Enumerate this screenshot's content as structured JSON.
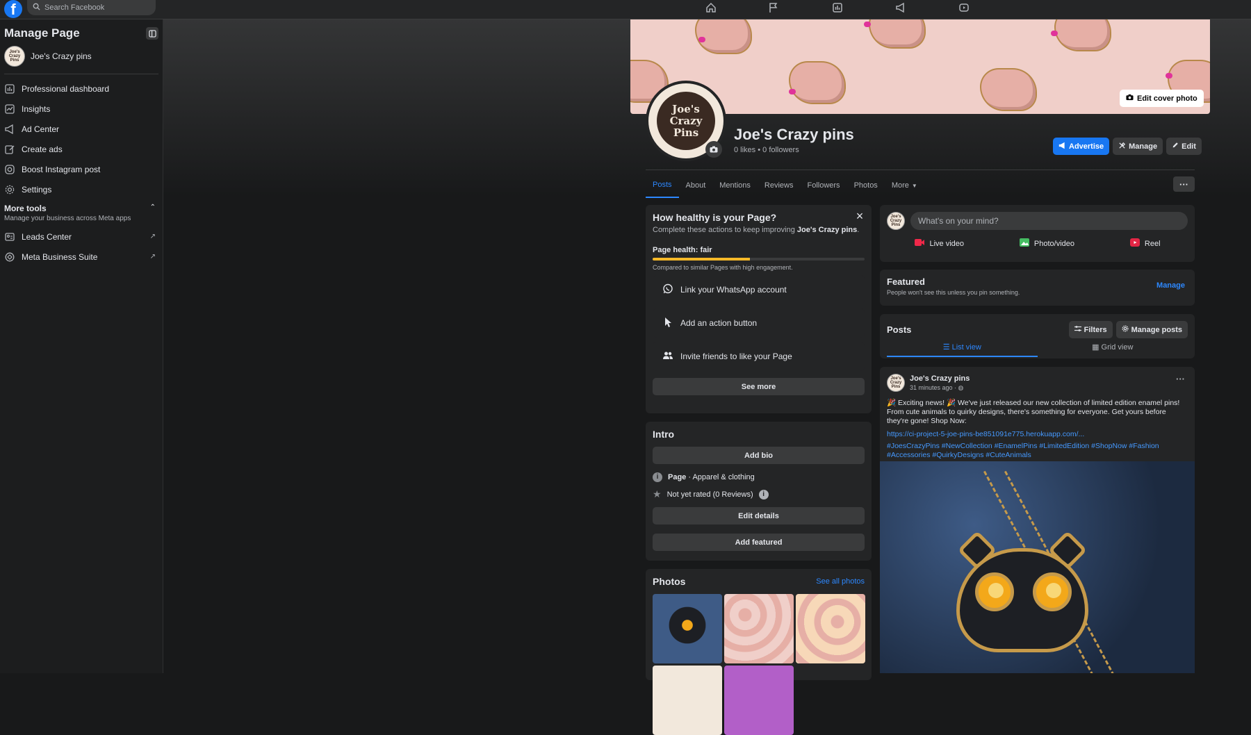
{
  "topbar": {
    "logo": "f",
    "search_placeholder": "Search Facebook",
    "nav_icons": [
      "home-icon",
      "flag-icon",
      "insights-icon",
      "megaphone-icon",
      "video-icon"
    ]
  },
  "sidebar": {
    "title": "Manage Page",
    "page_name": "Joe's Crazy pins",
    "items": [
      {
        "label": "Professional dashboard",
        "icon": "dashboard-icon"
      },
      {
        "label": "Insights",
        "icon": "insights-icon"
      },
      {
        "label": "Ad Center",
        "icon": "megaphone-icon"
      },
      {
        "label": "Create ads",
        "icon": "edit-icon"
      },
      {
        "label": "Boost Instagram post",
        "icon": "instagram-icon"
      },
      {
        "label": "Settings",
        "icon": "gear-icon"
      }
    ],
    "more_tools": {
      "title": "More tools",
      "subtitle": "Manage your business across Meta apps",
      "items": [
        {
          "label": "Leads Center",
          "icon": "leads-icon"
        },
        {
          "label": "Meta Business Suite",
          "icon": "business-suite-icon"
        }
      ]
    }
  },
  "profile": {
    "edit_cover_label": "Edit cover photo",
    "logo_text": "Joe's Crazy Pins",
    "name": "Joe's Crazy pins",
    "stats": "0 likes • 0 followers",
    "advertise_label": "Advertise",
    "manage_label": "Manage",
    "edit_label": "Edit",
    "tabs": [
      "Posts",
      "About",
      "Mentions",
      "Reviews",
      "Followers",
      "Photos",
      "More"
    ],
    "more_dots": "···"
  },
  "health": {
    "title": "How healthy is your Page?",
    "subtitle_pre": "Complete these actions to keep improving ",
    "subtitle_bold": "Joe's Crazy pins",
    "subtitle_post": ".",
    "label": "Page health: fair",
    "progress": 0.46,
    "note": "Compared to similar Pages with high engagement.",
    "actions": [
      {
        "label": "Link your WhatsApp account",
        "icon": "whatsapp-icon"
      },
      {
        "label": "Add an action button",
        "icon": "cursor-icon"
      },
      {
        "label": "Invite friends to like your Page",
        "icon": "friends-icon"
      }
    ],
    "see_more_label": "See more"
  },
  "intro": {
    "title": "Intro",
    "add_bio_label": "Add bio",
    "page_type_bold": "Page",
    "page_type_rest": " · Apparel & clothing",
    "rating": "Not yet rated (0 Reviews)",
    "edit_details_label": "Edit details",
    "add_featured_label": "Add featured"
  },
  "photos": {
    "title": "Photos",
    "see_all_label": "See all photos"
  },
  "composer": {
    "placeholder": "What's on your mind?",
    "buttons": [
      {
        "label": "Live video",
        "color": "#f02849"
      },
      {
        "label": "Photo/video",
        "color": "#45bd62"
      },
      {
        "label": "Reel",
        "color": "#e42645"
      }
    ]
  },
  "featured": {
    "title": "Featured",
    "note": "People won't see this unless you pin something.",
    "manage_label": "Manage"
  },
  "posts": {
    "title": "Posts",
    "filters_label": "Filters",
    "manage_posts_label": "Manage posts",
    "list_view_label": "List view",
    "grid_view_label": "Grid view"
  },
  "post": {
    "author": "Joe's Crazy pins",
    "time": "31 minutes ago · ",
    "text": "🎉 Exciting news! 🎉 We've just released our new collection of limited edition enamel pins! From cute animals to quirky designs, there's something for everyone. Get yours before they're gone! Shop Now:",
    "link": "https://ci-project-5-joe-pins-be851091e775.herokuapp.com/...",
    "tags": "#JoesCrazyPins #NewCollection #EnamelPins #LimitedEdition #ShopNow #Fashion #Accessories #QuirkyDesigns #CuteAnimals"
  },
  "colors": {
    "accent": "#2d88ff",
    "brand": "#1877f2",
    "background": "#18191a",
    "card": "#242526",
    "health_fill": "#f7b928"
  }
}
